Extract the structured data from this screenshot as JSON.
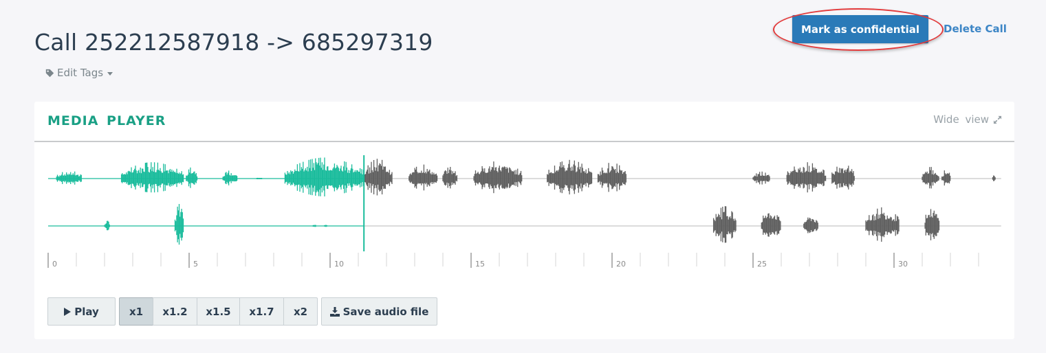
{
  "header": {
    "title": "Call 252212587918 -> 685297319",
    "edit_tags_label": "Edit Tags",
    "mark_confidential_label": "Mark as confidential",
    "delete_call_label": "Delete Call"
  },
  "media_player": {
    "title": "MEDIA PLAYER",
    "wide_view_label": "Wide view",
    "duration_seconds": 33.8,
    "playhead_seconds": 11.2,
    "colors": {
      "played": "#1abc9c",
      "unplayed": "#606060",
      "baseline": "#c8c8c8",
      "accent": "#1aa085"
    },
    "timeline": {
      "labels": [
        "0",
        "5",
        "10",
        "15",
        "20",
        "25",
        "30"
      ],
      "major_every_seconds": 5,
      "minor_every_seconds": 1
    },
    "channels": [
      {
        "name": "channel-1",
        "segments": [
          [
            0.3,
            1.2,
            0.35
          ],
          [
            2.6,
            4.8,
            0.7
          ],
          [
            4.9,
            5.3,
            0.5
          ],
          [
            6.2,
            6.7,
            0.35
          ],
          [
            7.4,
            7.6,
            0.05
          ],
          [
            8.4,
            11.2,
            0.9
          ],
          [
            11.2,
            12.2,
            0.85
          ],
          [
            12.8,
            13.8,
            0.6
          ],
          [
            14.0,
            14.5,
            0.5
          ],
          [
            15.1,
            16.8,
            0.75
          ],
          [
            17.7,
            19.3,
            0.8
          ],
          [
            19.5,
            20.5,
            0.7
          ],
          [
            25.0,
            25.6,
            0.3
          ],
          [
            26.2,
            27.6,
            0.7
          ],
          [
            27.8,
            28.6,
            0.65
          ],
          [
            31.0,
            31.6,
            0.5
          ],
          [
            31.7,
            32.0,
            0.4
          ],
          [
            33.5,
            33.6,
            0.15
          ]
        ]
      },
      {
        "name": "channel-2",
        "segments": [
          [
            2.0,
            2.2,
            0.3
          ],
          [
            4.5,
            4.8,
            1.0
          ],
          [
            9.4,
            9.5,
            0.1
          ],
          [
            9.8,
            9.9,
            0.1
          ],
          [
            23.6,
            24.4,
            0.9
          ],
          [
            25.3,
            26.0,
            0.85
          ],
          [
            26.8,
            27.3,
            0.55
          ],
          [
            29.0,
            30.2,
            0.85
          ],
          [
            31.1,
            31.6,
            1.0
          ]
        ]
      }
    ],
    "controls": {
      "play_label": "Play",
      "speeds": [
        "x1",
        "x1.2",
        "x1.5",
        "x1.7",
        "x2"
      ],
      "active_speed": "x1",
      "save_label": "Save audio file"
    }
  }
}
